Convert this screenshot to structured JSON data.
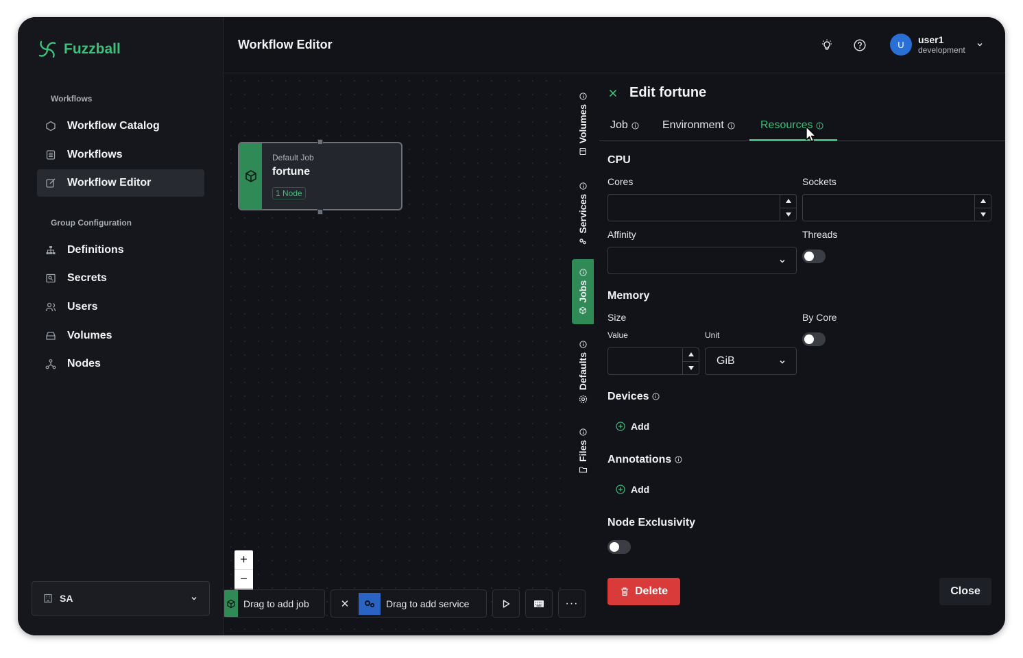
{
  "app": {
    "name": "Fuzzball"
  },
  "sidebar": {
    "heading_workflows": "Workflows",
    "workflow_items": [
      {
        "label": "Workflow Catalog",
        "icon": "hexagon-icon"
      },
      {
        "label": "Workflows",
        "icon": "list-icon"
      },
      {
        "label": "Workflow Editor",
        "icon": "edit-icon",
        "active": true
      }
    ],
    "heading_group": "Group Configuration",
    "group_items": [
      {
        "label": "Definitions",
        "icon": "sitemap-icon"
      },
      {
        "label": "Secrets",
        "icon": "key-icon"
      },
      {
        "label": "Users",
        "icon": "users-icon"
      },
      {
        "label": "Volumes",
        "icon": "drive-icon"
      },
      {
        "label": "Nodes",
        "icon": "nodes-icon"
      }
    ],
    "org": "SA"
  },
  "header": {
    "title": "Workflow Editor",
    "user_initial": "U",
    "user_name": "user1",
    "user_env": "development"
  },
  "canvas": {
    "node": {
      "type": "Default Job",
      "name": "fortune",
      "badge": "1 Node"
    },
    "zoom_in": "+",
    "zoom_out": "−",
    "drag_job": "Drag to add job",
    "drag_service": "Drag to add service"
  },
  "side_tabs": [
    {
      "label": "Volumes"
    },
    {
      "label": "Services"
    },
    {
      "label": "Jobs",
      "active": true
    },
    {
      "label": "Defaults"
    },
    {
      "label": "Files"
    }
  ],
  "panel": {
    "title": "Edit fortune",
    "tabs": [
      {
        "label": "Job"
      },
      {
        "label": "Environment"
      },
      {
        "label": "Resources",
        "active": true
      }
    ],
    "cpu": {
      "heading": "CPU",
      "cores_label": "Cores",
      "cores_value": "",
      "sockets_label": "Sockets",
      "sockets_value": "",
      "affinity_label": "Affinity",
      "affinity_value": "",
      "threads_label": "Threads",
      "threads_on": false
    },
    "memory": {
      "heading": "Memory",
      "size_label": "Size",
      "value_label": "Value",
      "value": "",
      "unit_label": "Unit",
      "unit": "GiB",
      "by_core_label": "By Core",
      "by_core_on": false
    },
    "devices": {
      "heading": "Devices",
      "add": "Add"
    },
    "annotations": {
      "heading": "Annotations",
      "add": "Add"
    },
    "node_exclusivity": {
      "heading": "Node Exclusivity",
      "on": false
    },
    "delete": "Delete",
    "close": "Close"
  },
  "colors": {
    "accent": "#3fbf7a",
    "danger": "#d93b3b",
    "background": "#111318"
  }
}
